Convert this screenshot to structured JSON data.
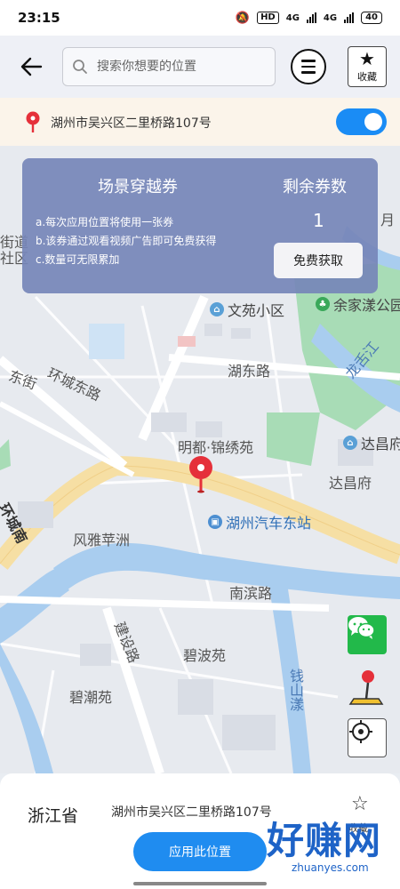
{
  "status_bar": {
    "time": "23:15",
    "hd_label": "HD",
    "signal_1": "4G",
    "signal_2": "4G",
    "battery": "40"
  },
  "top_bar": {
    "search_placeholder": "搜索你想要的位置",
    "favorite_label": "收藏"
  },
  "location_bar": {
    "address": "湖州市吴兴区二里桥路107号",
    "toggle_on": true,
    "accent_color": "#1a8cf5"
  },
  "ticket": {
    "title": "场景穿越券",
    "count_title": "剩余券数",
    "rules": [
      "a.每次应用位置将使用一张券",
      "b.该券通过观看视频广告即可免费获得",
      "c.数量可无限累加"
    ],
    "count": "1",
    "button_label": "免费获取"
  },
  "map": {
    "labels": {
      "jiedao": "街道",
      "shequ": "社区",
      "huanchengdonglu": "环城东路",
      "dongjie": "东街",
      "huanchengnan": "环城南",
      "wenyuan": "文苑小区",
      "yujiayang": "余家漾公园",
      "longshejiang": "龙舌江",
      "hudonglu": "湖东路",
      "dachang": "达昌府",
      "dachang_poi": "达昌府",
      "mingdu": "明都·锦绣苑",
      "bus_station": "湖州汽车东站",
      "fengya": "风雅苹洲",
      "nanbinlu": "南滨路",
      "jiansheru": "建设路",
      "bibo": "碧波苑",
      "qianshanyang": "钱山漾",
      "bichao": "碧潮苑",
      "yue": "月"
    }
  },
  "bottom_sheet": {
    "province": "浙江省",
    "address": "湖州市吴兴区二里桥路107号",
    "favorite_label": "收藏",
    "apply_label": "应用此位置"
  },
  "watermark": {
    "big": "好赚网",
    "small": "zhuanyes.com"
  },
  "colors": {
    "apply_button": "#1f8cf0",
    "pin": "#e5303a",
    "wechat": "#22b94a",
    "water": "#a9cdef",
    "park": "#a8dcb6",
    "road": "#f6dfa4"
  }
}
